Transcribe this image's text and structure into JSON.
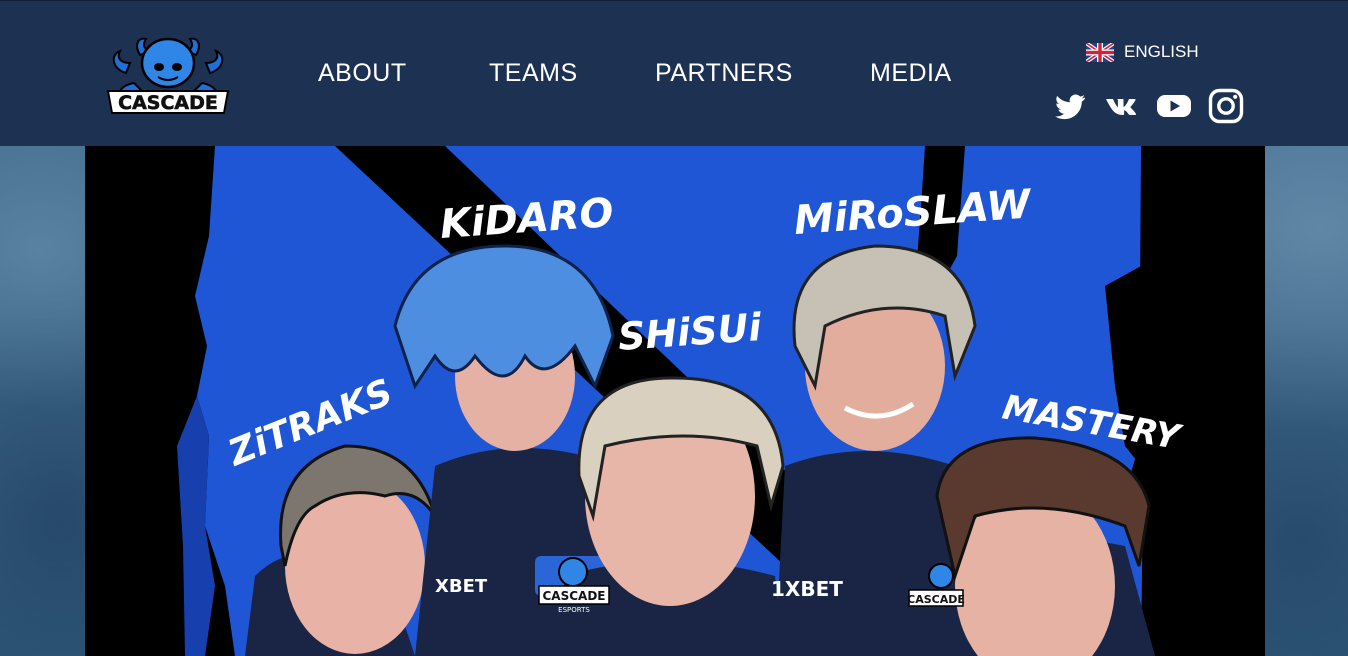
{
  "header": {
    "logo_text": "CASCADE",
    "nav": [
      {
        "label": "ABOUT"
      },
      {
        "label": "TEAMS"
      },
      {
        "label": "PARTNERS"
      },
      {
        "label": "MEDIA"
      }
    ],
    "language": {
      "label": "ENGLISH",
      "flag": "uk-flag-icon"
    },
    "socials": [
      {
        "name": "twitter-icon"
      },
      {
        "name": "vk-icon"
      },
      {
        "name": "youtube-icon"
      },
      {
        "name": "instagram-icon"
      }
    ]
  },
  "banner": {
    "players": [
      {
        "name": "KiDARO"
      },
      {
        "name": "MiRoSLAW"
      },
      {
        "name": "SHiSUi"
      },
      {
        "name": "ZiTRAKS"
      },
      {
        "name": "MASTERY"
      }
    ],
    "sponsor_text": "1XBET",
    "sponsor_text_partial": "XBET",
    "team_badge_text": "CASCADE",
    "team_badge_subtext": "ESPORTS"
  },
  "colors": {
    "header_bg": "#1d3152",
    "banner_blue": "#1f56d6",
    "banner_black": "#000000",
    "text": "#ffffff"
  }
}
